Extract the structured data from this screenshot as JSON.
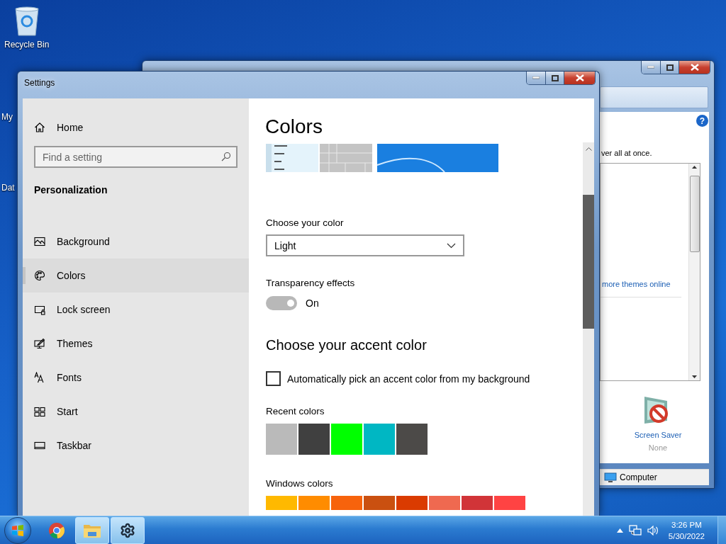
{
  "desktop": {
    "icons": [
      {
        "label": "Recycle Bin",
        "kind": "recycle"
      },
      {
        "label": "My",
        "kind": "partial"
      },
      {
        "label": "Dat",
        "kind": "partial"
      }
    ]
  },
  "back_window": {
    "help_glyph": "?",
    "intro_text": "ver all at once.",
    "link": "more themes online",
    "screen_saver": {
      "label": "Screen Saver",
      "value": "None"
    },
    "status_bar": "Computer"
  },
  "settings_window": {
    "title": "Settings",
    "sidebar": {
      "home": "Home",
      "search": {
        "placeholder": "Find a setting"
      },
      "section": "Personalization",
      "items": [
        {
          "label": "Background",
          "kind": "background",
          "selected": false
        },
        {
          "label": "Colors",
          "kind": "colors",
          "selected": true
        },
        {
          "label": "Lock screen",
          "kind": "lock",
          "selected": false
        },
        {
          "label": "Themes",
          "kind": "themes",
          "selected": false
        },
        {
          "label": "Fonts",
          "kind": "fonts",
          "selected": false
        },
        {
          "label": "Start",
          "kind": "start",
          "selected": false
        },
        {
          "label": "Taskbar",
          "kind": "taskbar",
          "selected": false
        }
      ]
    },
    "content": {
      "title": "Colors",
      "color_mode": {
        "label": "Choose your color",
        "value": "Light"
      },
      "transparency": {
        "label": "Transparency effects",
        "on": true,
        "state_text": "On"
      },
      "accent_heading": "Choose your accent color",
      "auto_pick": {
        "label": "Automatically pick an accent color from my background",
        "checked": false
      },
      "recent_colors": {
        "label": "Recent colors",
        "swatches": [
          {
            "color": "#bababa"
          },
          {
            "color": "#404040"
          },
          {
            "color": "#00ff00"
          },
          {
            "color": "#00b7c3"
          },
          {
            "color": "#4c4a48"
          }
        ]
      },
      "windows_colors": {
        "label": "Windows colors",
        "swatches": [
          {
            "color": "#ffb900"
          },
          {
            "color": "#ff8c00"
          },
          {
            "color": "#f7630c"
          },
          {
            "color": "#ca5010"
          },
          {
            "color": "#da3b01"
          },
          {
            "color": "#ef6950"
          },
          {
            "color": "#d13438"
          },
          {
            "color": "#ff4343"
          }
        ]
      }
    }
  },
  "taskbar": {
    "apps": [
      {
        "kind": "browser",
        "running": false
      },
      {
        "kind": "folder",
        "running": true
      },
      {
        "kind": "settings",
        "running": true
      }
    ],
    "clock": {
      "time": "3:26 PM",
      "date": "5/30/2022"
    }
  }
}
